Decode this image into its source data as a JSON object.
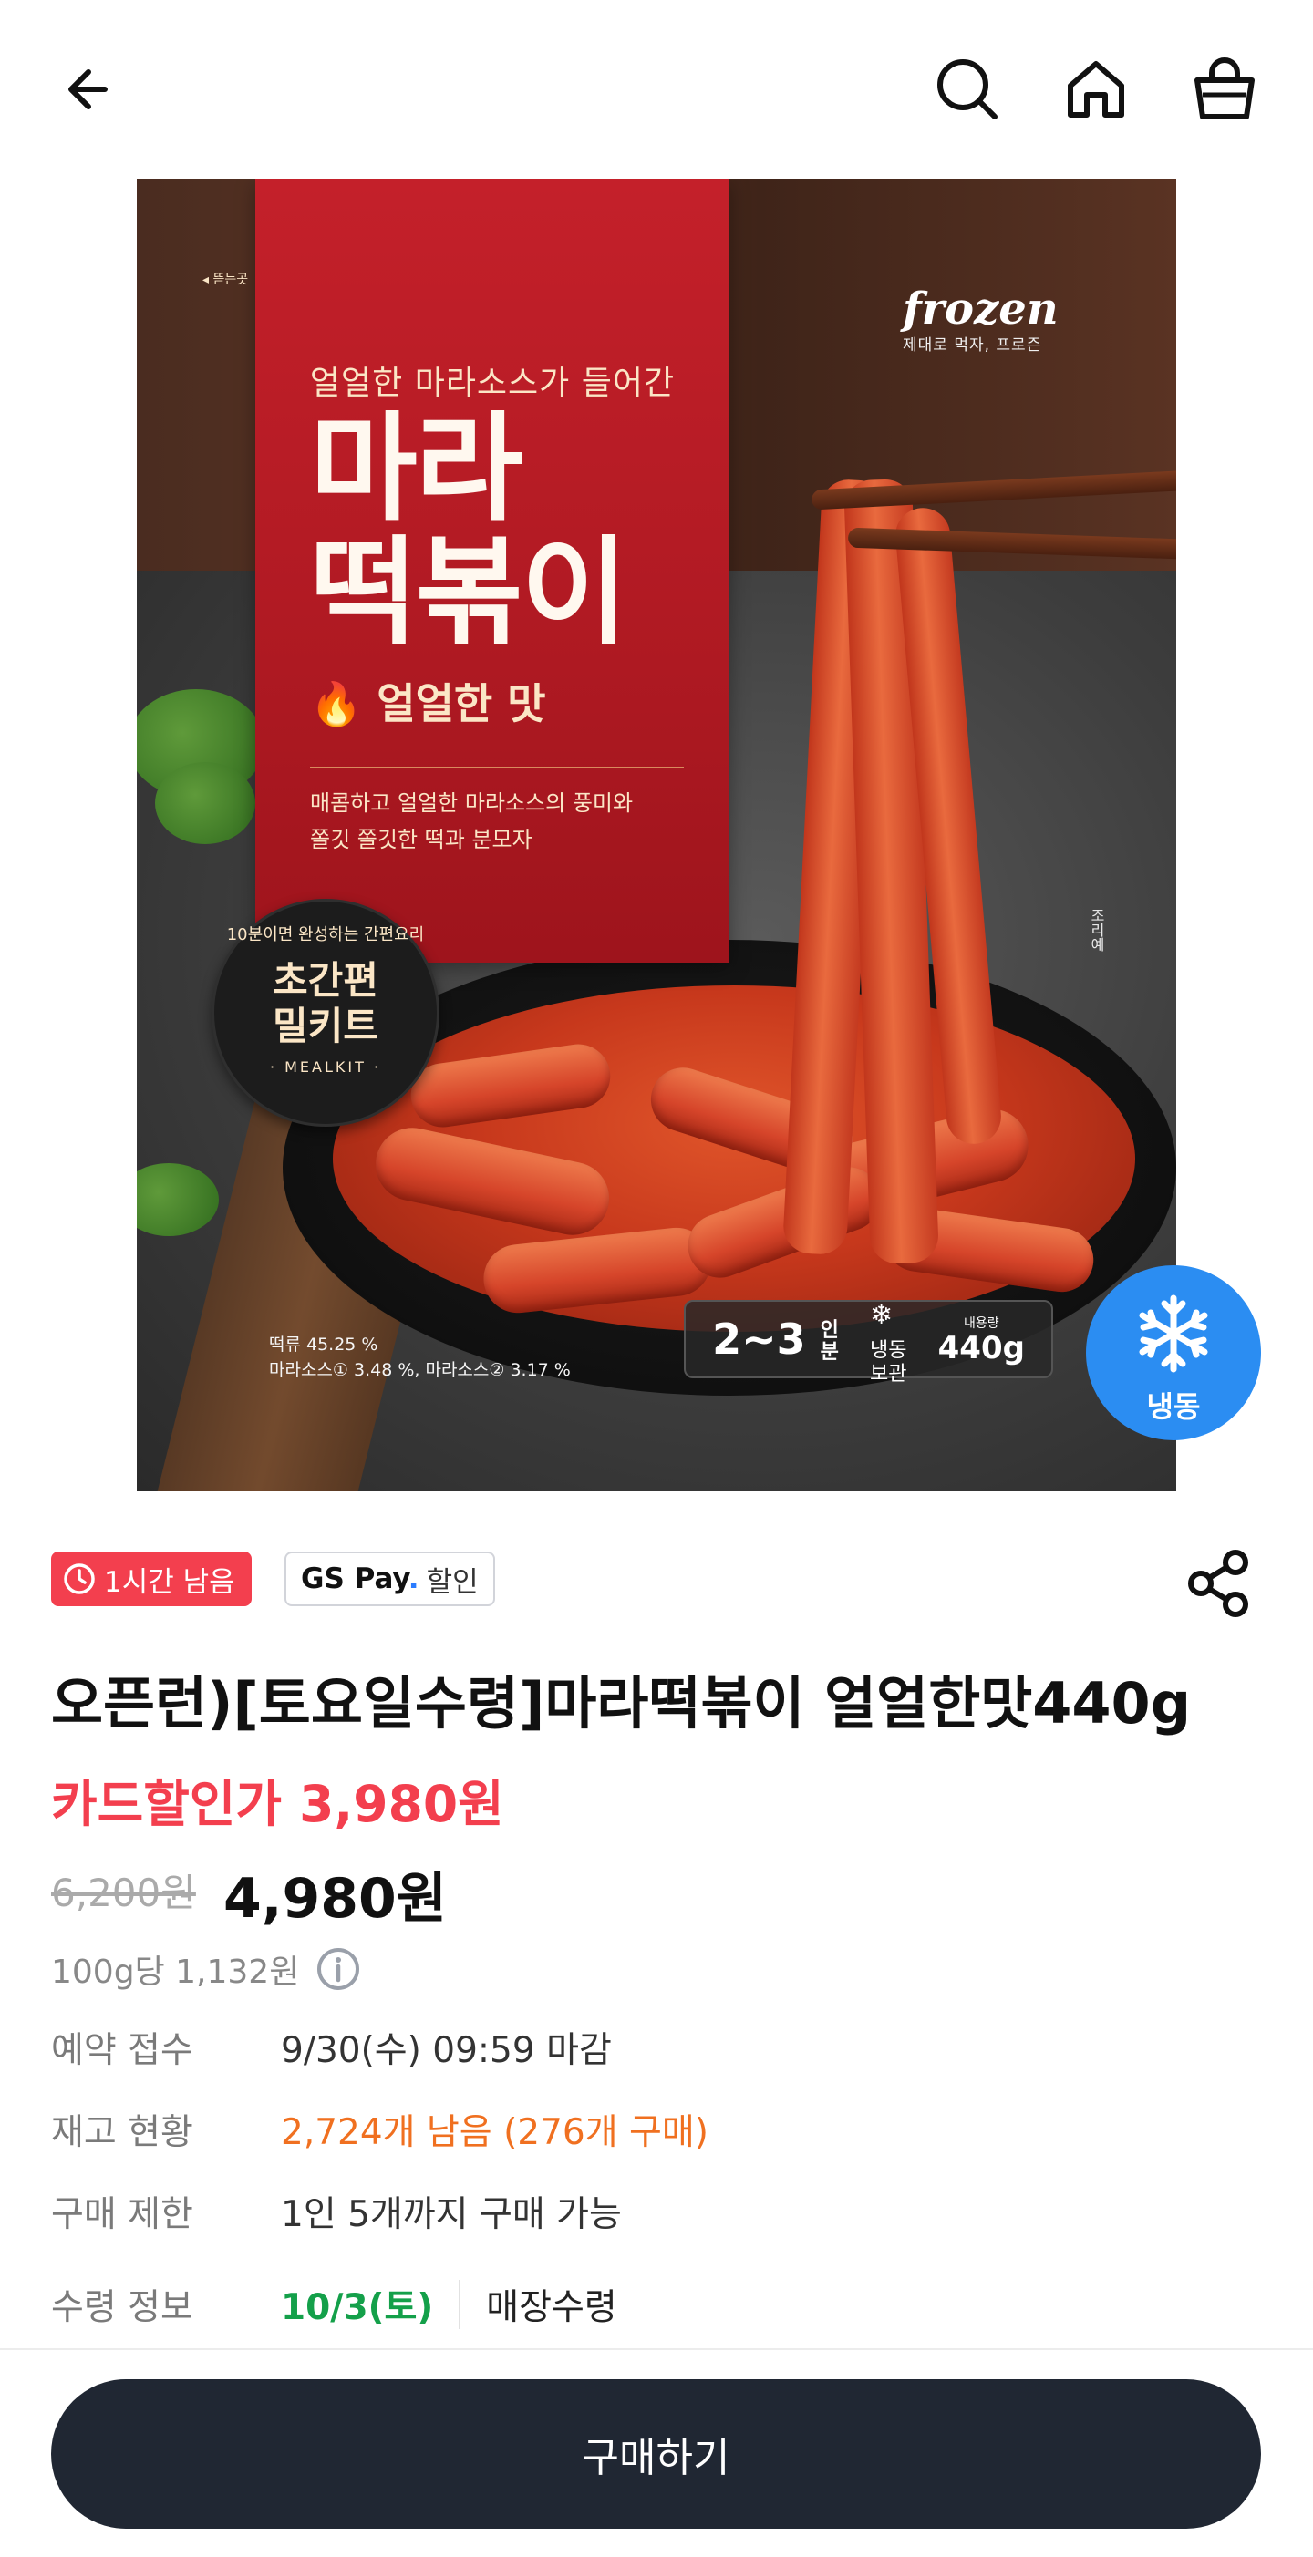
{
  "header": {
    "back_icon": "arrow-left-icon",
    "search_icon": "search-icon",
    "home_icon": "home-icon",
    "cart_icon": "shopping-bag-icon"
  },
  "product_image": {
    "panel_subtitle": "얼얼한 마라소스가 들어간",
    "panel_title_line1": "마라",
    "panel_title_line2": "떡볶이",
    "panel_flavor": "얼얼한 맛",
    "panel_desc_line1": "매콤하고 얼얼한 마라소스의 풍미와",
    "panel_desc_line2": "쫄깃 쫄깃한 떡과 분모자",
    "brand_word": "frozen",
    "brand_tag": "제대로 먹자, 프로즌",
    "badge_arc": "10분이면 완성하는 간편요리",
    "badge_line1": "초간편",
    "badge_line2": "밀키트",
    "badge_small": "· MEALKIT ·",
    "ingredients_line1": "떡류 45.25 %",
    "ingredients_line2": "마라소스① 3.48 %, 마라소스② 3.17 %",
    "serving": "2~3",
    "serving_unit_1": "인",
    "serving_unit_2": "분",
    "storage_line1": "냉동",
    "storage_line2": "보관",
    "volume_label": "내용량",
    "volume_value": "440g",
    "side_text": "조리예",
    "corner_text": "◂ 뜯는곳",
    "frozen_badge_label": "냉동",
    "frozen_badge_icon": "snowflake-icon"
  },
  "tags": {
    "time_left": "1시간 남음",
    "pay_brand": "GS Pay",
    "pay_dot": ".",
    "pay_label": "할인"
  },
  "product": {
    "title": "오픈런)[토요일수령]마라떡볶이 얼얼한맛440g",
    "card_price": "카드할인가 3,980원",
    "original_price": "6,200원",
    "sale_price": "4,980원",
    "unit_price": "100g당 1,132원"
  },
  "details": [
    {
      "key": "예약 접수",
      "value": "9/30(수) 09:59 마감"
    },
    {
      "key": "재고 현황",
      "value": "2,724개 남음 (276개 구매)"
    },
    {
      "key": "구매 제한",
      "value": "1인 5개까지 구매 가능"
    },
    {
      "key": "수령 정보",
      "value": "10/3(토)",
      "extra": "매장수령"
    }
  ],
  "buy_button": "구매하기",
  "colors": {
    "accent_red": "#f33f4e",
    "stock_orange": "#f07020",
    "pickup_green": "#14a04a",
    "button_dark": "#202733",
    "frozen_blue": "#2b8df2"
  }
}
